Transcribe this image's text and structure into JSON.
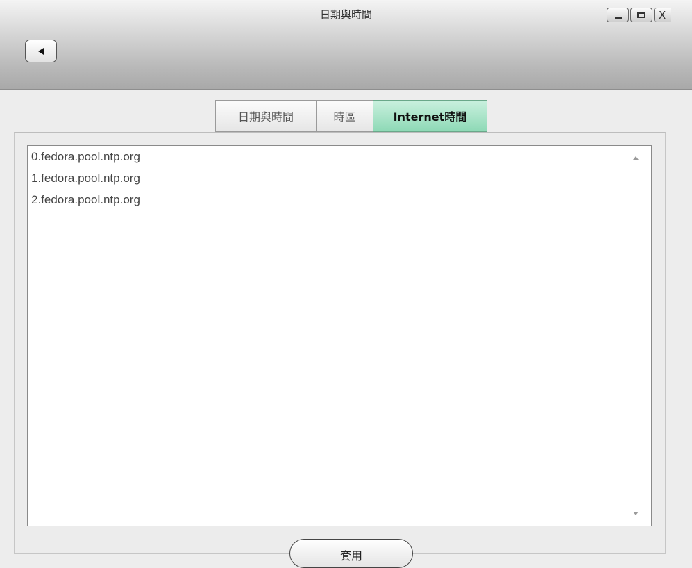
{
  "window": {
    "title": "日期與時間",
    "controls": {
      "minimize": "minimize-icon",
      "maximize": "maximize-icon",
      "close": "X"
    }
  },
  "toolbar": {
    "back_icon": "back-arrow-icon"
  },
  "tabs": [
    {
      "label": "日期與時間",
      "selected": false
    },
    {
      "label": "時區",
      "selected": false
    },
    {
      "label": "Internet時間",
      "selected": true
    }
  ],
  "servers": [
    "0.fedora.pool.ntp.org",
    "1.fedora.pool.ntp.org",
    "2.fedora.pool.ntp.org"
  ],
  "apply_label": "套用",
  "colors": {
    "active_tab": "#9fe0c2",
    "titlebar": "#b9b9b9",
    "background": "#ededed"
  }
}
